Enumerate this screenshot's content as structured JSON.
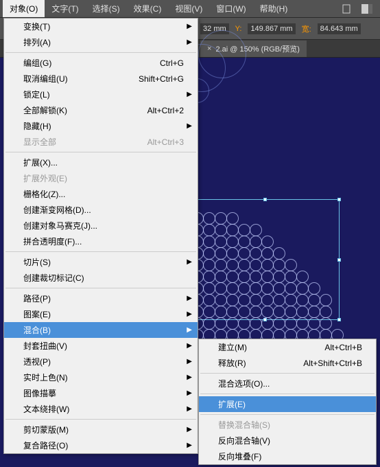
{
  "menubar": {
    "items": [
      "对象(O)",
      "文字(T)",
      "选择(S)",
      "效果(C)",
      "视图(V)",
      "窗口(W)",
      "帮助(H)"
    ],
    "active_index": 0
  },
  "toolbar": {
    "x_val": "32",
    "x_unit": "mm",
    "y_label": "Y:",
    "y_val": "149.867",
    "y_unit": "mm",
    "w_label": "宽:",
    "w_val": "84.643",
    "w_unit": "mm"
  },
  "tab": {
    "label": "2.ai @ 150% (RGB/预览)",
    "close": "×"
  },
  "menu": [
    {
      "type": "item",
      "label": "变换(T)",
      "arrow": true
    },
    {
      "type": "item",
      "label": "排列(A)",
      "arrow": true
    },
    {
      "type": "sep"
    },
    {
      "type": "item",
      "label": "编组(G)",
      "shortcut": "Ctrl+G"
    },
    {
      "type": "item",
      "label": "取消编组(U)",
      "shortcut": "Shift+Ctrl+G"
    },
    {
      "type": "item",
      "label": "锁定(L)",
      "arrow": true
    },
    {
      "type": "item",
      "label": "全部解锁(K)",
      "shortcut": "Alt+Ctrl+2"
    },
    {
      "type": "item",
      "label": "隐藏(H)",
      "arrow": true
    },
    {
      "type": "item",
      "label": "显示全部",
      "shortcut": "Alt+Ctrl+3",
      "disabled": true
    },
    {
      "type": "sep"
    },
    {
      "type": "item",
      "label": "扩展(X)..."
    },
    {
      "type": "item",
      "label": "扩展外观(E)",
      "disabled": true
    },
    {
      "type": "item",
      "label": "栅格化(Z)..."
    },
    {
      "type": "item",
      "label": "创建渐变网格(D)..."
    },
    {
      "type": "item",
      "label": "创建对象马赛克(J)..."
    },
    {
      "type": "item",
      "label": "拼合透明度(F)..."
    },
    {
      "type": "sep"
    },
    {
      "type": "item",
      "label": "切片(S)",
      "arrow": true
    },
    {
      "type": "item",
      "label": "创建裁切标记(C)"
    },
    {
      "type": "sep"
    },
    {
      "type": "item",
      "label": "路径(P)",
      "arrow": true
    },
    {
      "type": "item",
      "label": "图案(E)",
      "arrow": true
    },
    {
      "type": "item",
      "label": "混合(B)",
      "arrow": true,
      "highlighted": true
    },
    {
      "type": "item",
      "label": "封套扭曲(V)",
      "arrow": true
    },
    {
      "type": "item",
      "label": "透视(P)",
      "arrow": true
    },
    {
      "type": "item",
      "label": "实时上色(N)",
      "arrow": true
    },
    {
      "type": "item",
      "label": "图像描摹",
      "arrow": true
    },
    {
      "type": "item",
      "label": "文本绕排(W)",
      "arrow": true
    },
    {
      "type": "sep"
    },
    {
      "type": "item",
      "label": "剪切蒙版(M)",
      "arrow": true
    },
    {
      "type": "item",
      "label": "复合路径(O)",
      "arrow": true
    }
  ],
  "submenu": [
    {
      "type": "item",
      "label": "建立(M)",
      "shortcut": "Alt+Ctrl+B"
    },
    {
      "type": "item",
      "label": "释放(R)",
      "shortcut": "Alt+Shift+Ctrl+B"
    },
    {
      "type": "sep"
    },
    {
      "type": "item",
      "label": "混合选项(O)..."
    },
    {
      "type": "sep"
    },
    {
      "type": "item",
      "label": "扩展(E)",
      "highlighted": true
    },
    {
      "type": "sep"
    },
    {
      "type": "item",
      "label": "替换混合轴(S)",
      "disabled": true
    },
    {
      "type": "item",
      "label": "反向混合轴(V)"
    },
    {
      "type": "item",
      "label": "反向堆叠(F)"
    }
  ]
}
